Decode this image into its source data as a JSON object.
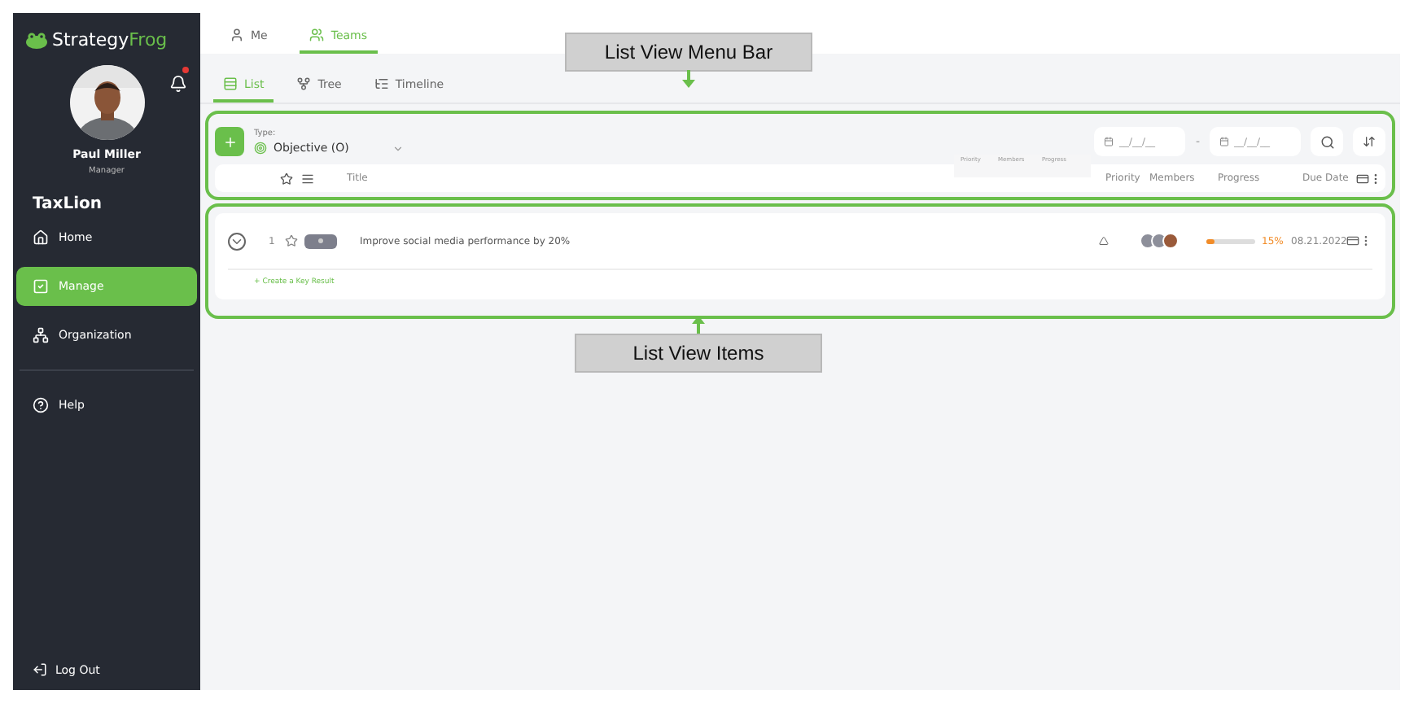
{
  "sidebar": {
    "brand": {
      "first": "Strategy",
      "second": "Frog"
    },
    "notifications": {
      "unread": true
    },
    "user": {
      "name": "Paul Miller",
      "role": "Manager"
    },
    "organization": "TaxLion",
    "items": [
      {
        "label": "Home",
        "selected": false
      },
      {
        "label": "Manage",
        "selected": true
      },
      {
        "label": "Organization",
        "selected": false
      },
      {
        "label": "Help",
        "selected": false
      }
    ],
    "logout": "Log Out"
  },
  "top_tabs": [
    {
      "label": "Me",
      "selected": false
    },
    {
      "label": "Teams",
      "selected": true
    }
  ],
  "view_tabs": [
    {
      "label": "List",
      "selected": true
    },
    {
      "label": "Tree",
      "selected": false
    },
    {
      "label": "Timeline",
      "selected": false
    }
  ],
  "menu_bar": {
    "type_label": "Type:",
    "type_value": "Objective (O)",
    "date_from": {
      "placeholder": "__/__/__"
    },
    "date_separator": "-",
    "date_to": {
      "placeholder": "__/__/__"
    },
    "columns": {
      "title": "Title",
      "priority": "Priority",
      "members": "Members",
      "progress": "Progress",
      "due_date": "Due Date"
    },
    "drag_ghost": [
      "Priority",
      "Members",
      "Progress"
    ]
  },
  "rows": [
    {
      "number": "1",
      "starred": false,
      "title": "Improve social media performance by 20%",
      "progress": {
        "level": 0.15,
        "reading": "15%"
      },
      "due_date": "08.21.2022",
      "add_link": "+ Create a Key Result"
    }
  ],
  "annotations": [
    "List View Menu Bar",
    "List View Items"
  ]
}
